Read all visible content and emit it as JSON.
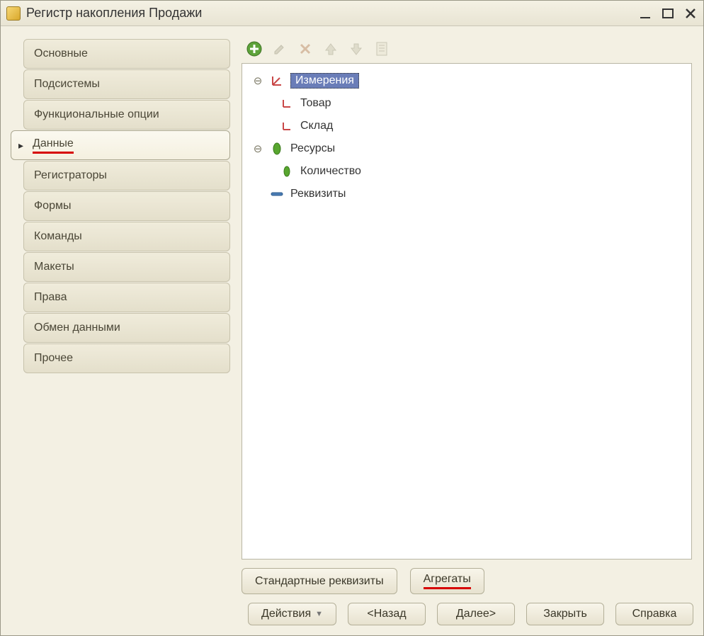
{
  "window": {
    "title": "Регистр накопления Продажи"
  },
  "sidebar": {
    "items": [
      {
        "label": "Основные",
        "active": false
      },
      {
        "label": "Подсистемы",
        "active": false
      },
      {
        "label": "Функциональные опции",
        "active": false
      },
      {
        "label": "Данные",
        "active": true
      },
      {
        "label": "Регистраторы",
        "active": false
      },
      {
        "label": "Формы",
        "active": false
      },
      {
        "label": "Команды",
        "active": false
      },
      {
        "label": "Макеты",
        "active": false
      },
      {
        "label": "Права",
        "active": false
      },
      {
        "label": "Обмен данными",
        "active": false
      },
      {
        "label": "Прочее",
        "active": false
      }
    ]
  },
  "toolbar": {
    "add": "Добавить",
    "edit": "Изменить",
    "delete": "Удалить",
    "up": "Вверх",
    "down": "Вниз",
    "props": "Свойства"
  },
  "tree": {
    "dimensions": {
      "label": "Измерения",
      "children": [
        "Товар",
        "Склад"
      ]
    },
    "resources": {
      "label": "Ресурсы",
      "children": [
        "Количество"
      ]
    },
    "attributes": {
      "label": "Реквизиты"
    }
  },
  "buttons": {
    "std_attrs": "Стандартные реквизиты",
    "aggregates": "Агрегаты",
    "actions": "Действия",
    "back": "<Назад",
    "next": "Далее>",
    "close": "Закрыть",
    "help": "Справка"
  }
}
